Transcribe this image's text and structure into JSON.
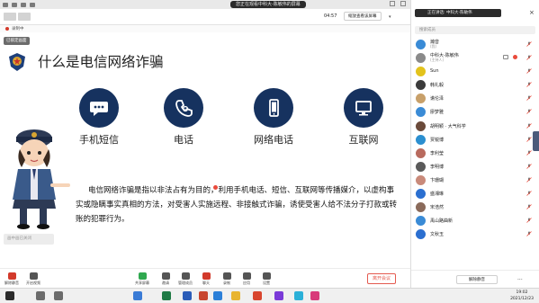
{
  "window": {
    "meeting_title": "您正在观看中科大-陈敏伟的屏幕",
    "time_elapsed": "04:57",
    "scale_button": "缩放查看该屏幕",
    "recording_label": "录制中",
    "scale_caret": "▾"
  },
  "slide": {
    "tag": "已锁定画面",
    "title": "什么是电信网络诈骗",
    "features": [
      {
        "label": "手机短信",
        "icon": "chat-bubble-icon"
      },
      {
        "label": "电话",
        "icon": "phone-icon"
      },
      {
        "label": "网络电话",
        "icon": "smartphone-icon"
      },
      {
        "label": "互联网",
        "icon": "monitor-icon"
      }
    ],
    "body": "电信网络诈骗是指以非法占有为目的，利用手机电话、短信、互联网等传播媒介，以虚构事实或隐瞒事实真相的方法，对受害人实施远程、非接触式诈骗，诱使受害人给不法分子打款或转账的犯罪行为。",
    "sub_caption": "画中画已关闭",
    "colors": {
      "icon_circle": "#16325f",
      "end_button": "#e45a4f",
      "cursor_dot": "#e94b3c"
    }
  },
  "toolbar": {
    "items": [
      {
        "label": "解除静音",
        "icon": "mic-icon"
      },
      {
        "label": "开启视频",
        "icon": "camera-icon"
      },
      {
        "label": "共享屏幕",
        "icon": "share-screen-icon"
      },
      {
        "label": "邀请",
        "icon": "invite-icon"
      },
      {
        "label": "管理成员",
        "icon": "members-icon"
      },
      {
        "label": "聊天",
        "icon": "chat-icon"
      },
      {
        "label": "录制",
        "icon": "record-icon"
      },
      {
        "label": "应用",
        "icon": "apps-icon"
      },
      {
        "label": "设置",
        "icon": "settings-icon"
      }
    ],
    "end_meeting": "离开会议"
  },
  "panel": {
    "speaking": "正在讲话: 中科大-陈敏伟",
    "close": "×",
    "search_placeholder": "搜索成员",
    "participants": [
      {
        "name": "瀚音",
        "role": "(我)",
        "avatar_color": "#3a8bd6"
      },
      {
        "name": "中科大-陈敏伟",
        "role": "(主持人)",
        "avatar_color": "#8a8a8a"
      },
      {
        "name": "Sun",
        "role": "",
        "avatar_color": "#e3c31c"
      },
      {
        "name": "韩礼毅",
        "role": "",
        "avatar_color": "#3b3b3b"
      },
      {
        "name": "谯伦泽",
        "role": "",
        "avatar_color": "#c8a06a"
      },
      {
        "name": "廖梦雅",
        "role": "",
        "avatar_color": "#3a8bd6"
      },
      {
        "name": "胡明颖 · 大气科学",
        "role": "",
        "avatar_color": "#6b4a3a"
      },
      {
        "name": "贾锐博",
        "role": "",
        "avatar_color": "#2b8fd0"
      },
      {
        "name": "李利莹",
        "role": "",
        "avatar_color": "#b86a5e"
      },
      {
        "name": "李明博",
        "role": "",
        "avatar_color": "#5a5a5a"
      },
      {
        "name": "卞珊瑚",
        "role": "",
        "avatar_color": "#c98a7a"
      },
      {
        "name": "盛湘琳",
        "role": "",
        "avatar_color": "#2b6fd0"
      },
      {
        "name": "宋浩然",
        "role": "",
        "avatar_color": "#8a6a5a"
      },
      {
        "name": "禹山路曲新",
        "role": "",
        "avatar_color": "#3a8bd6"
      },
      {
        "name": "文秋玉",
        "role": "",
        "avatar_color": "#2b6fd0"
      }
    ],
    "unmute_all": "解除静音",
    "more": "···"
  },
  "taskbar": {
    "time": "19:02",
    "date": "2021/12/23",
    "apps": [
      {
        "icon": "windows-start-icon",
        "color": "#2b2b2b"
      },
      {
        "icon": "search-icon",
        "color": "#6b6b6b"
      },
      {
        "icon": "task-view-icon",
        "color": "#6b6b6b"
      },
      {
        "icon": "browser-icon",
        "color": "#3a7bd6"
      },
      {
        "icon": "excel-icon",
        "color": "#1f7a45"
      },
      {
        "icon": "word-icon",
        "color": "#2b5cb8"
      },
      {
        "icon": "powerpoint-icon",
        "color": "#c8452e"
      },
      {
        "icon": "meeting-icon",
        "color": "#2b7fd8"
      },
      {
        "icon": "folder-icon",
        "color": "#e8b430"
      },
      {
        "icon": "chrome-icon",
        "color": "#d8452e"
      },
      {
        "icon": "app-icon",
        "color": "#7a3ad8"
      },
      {
        "icon": "app-icon",
        "color": "#2bb0d8"
      },
      {
        "icon": "app-icon",
        "color": "#d83a7a"
      }
    ]
  }
}
